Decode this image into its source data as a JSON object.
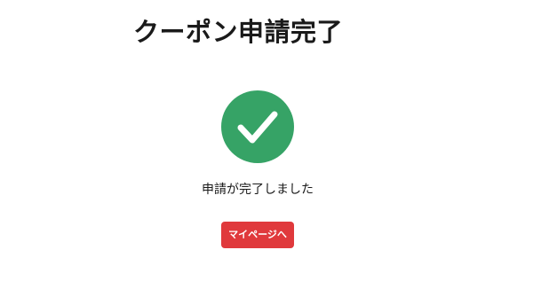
{
  "header": {
    "title": "クーポン申請完了"
  },
  "status": {
    "icon": "check-icon",
    "color": "#36a366",
    "message": "申請が完了しました"
  },
  "actions": {
    "mypage_label": "マイページへ",
    "mypage_color": "#e0393c"
  }
}
